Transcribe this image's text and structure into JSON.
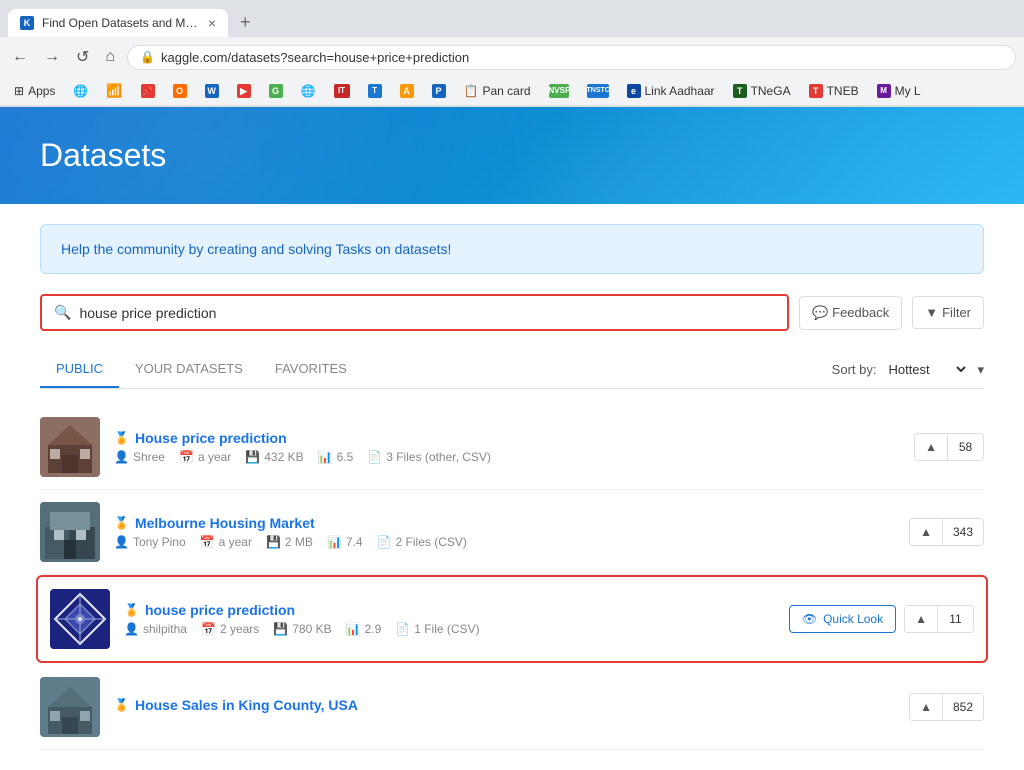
{
  "browser": {
    "tab": {
      "favicon": "K",
      "title": "Find Open Datasets and Machine...",
      "close": "×"
    },
    "new_tab": "+",
    "nav": {
      "back": "←",
      "forward": "→",
      "refresh": "↺",
      "home": "⌂",
      "lock": "🔒",
      "address": "kaggle.com/datasets?search=house+price+prediction"
    },
    "bookmarks": [
      {
        "label": "Apps",
        "icon": "⊞"
      },
      {
        "label": "",
        "icon": "🌐"
      },
      {
        "label": "",
        "icon": "📶"
      },
      {
        "label": "",
        "icon": "📌"
      },
      {
        "label": "",
        "icon": "O"
      },
      {
        "label": "",
        "icon": "W"
      },
      {
        "label": "",
        "icon": "▶"
      },
      {
        "label": "",
        "icon": "G"
      },
      {
        "label": "",
        "icon": "🌐"
      },
      {
        "label": "",
        "icon": "IT"
      },
      {
        "label": "",
        "icon": "T"
      },
      {
        "label": "",
        "icon": "A"
      },
      {
        "label": "",
        "icon": "P"
      },
      {
        "label": "Pan card",
        "icon": "P"
      },
      {
        "label": "NVSP",
        "icon": "N"
      },
      {
        "label": "TNSTC",
        "icon": "T"
      },
      {
        "label": "Link Aadhaar",
        "icon": "e"
      },
      {
        "label": "TNeGA",
        "icon": "T"
      },
      {
        "label": "TNEB",
        "icon": "T"
      },
      {
        "label": "My L",
        "icon": "M"
      }
    ]
  },
  "page": {
    "title": "Datasets",
    "community_banner": "Help the community by creating and solving Tasks on datasets!",
    "search": {
      "placeholder": "house price prediction",
      "value": "house price prediction",
      "feedback_label": "Feedback",
      "filter_label": "Filter"
    },
    "tabs": [
      {
        "label": "PUBLIC",
        "active": true
      },
      {
        "label": "YOUR DATASETS",
        "active": false
      },
      {
        "label": "FAVORITES",
        "active": false
      }
    ],
    "sort": {
      "label": "Sort by:",
      "value": "Hottest"
    },
    "datasets": [
      {
        "id": 1,
        "name": "House price prediction",
        "author": "Shree",
        "age": "a year",
        "size": "432 KB",
        "usability": "6.5",
        "files": "3 Files (other, CSV)",
        "upvotes": "58",
        "medal": "gold",
        "highlighted": false
      },
      {
        "id": 2,
        "name": "Melbourne Housing Market",
        "author": "Tony Pino",
        "age": "a year",
        "size": "2 MB",
        "usability": "7.4",
        "files": "2 Files (CSV)",
        "upvotes": "343",
        "medal": "gold",
        "highlighted": false
      },
      {
        "id": 3,
        "name": "house price prediction",
        "author": "shilpitha",
        "age": "2 years",
        "size": "780 KB",
        "usability": "2.9",
        "files": "1 File (CSV)",
        "upvotes": "11",
        "medal": "gold",
        "highlighted": true,
        "quick_look": "Quick Look"
      },
      {
        "id": 4,
        "name": "House Sales in King County, USA",
        "author": "",
        "age": "",
        "size": "",
        "usability": "",
        "files": "",
        "upvotes": "852",
        "medal": "gold",
        "highlighted": false
      }
    ]
  }
}
